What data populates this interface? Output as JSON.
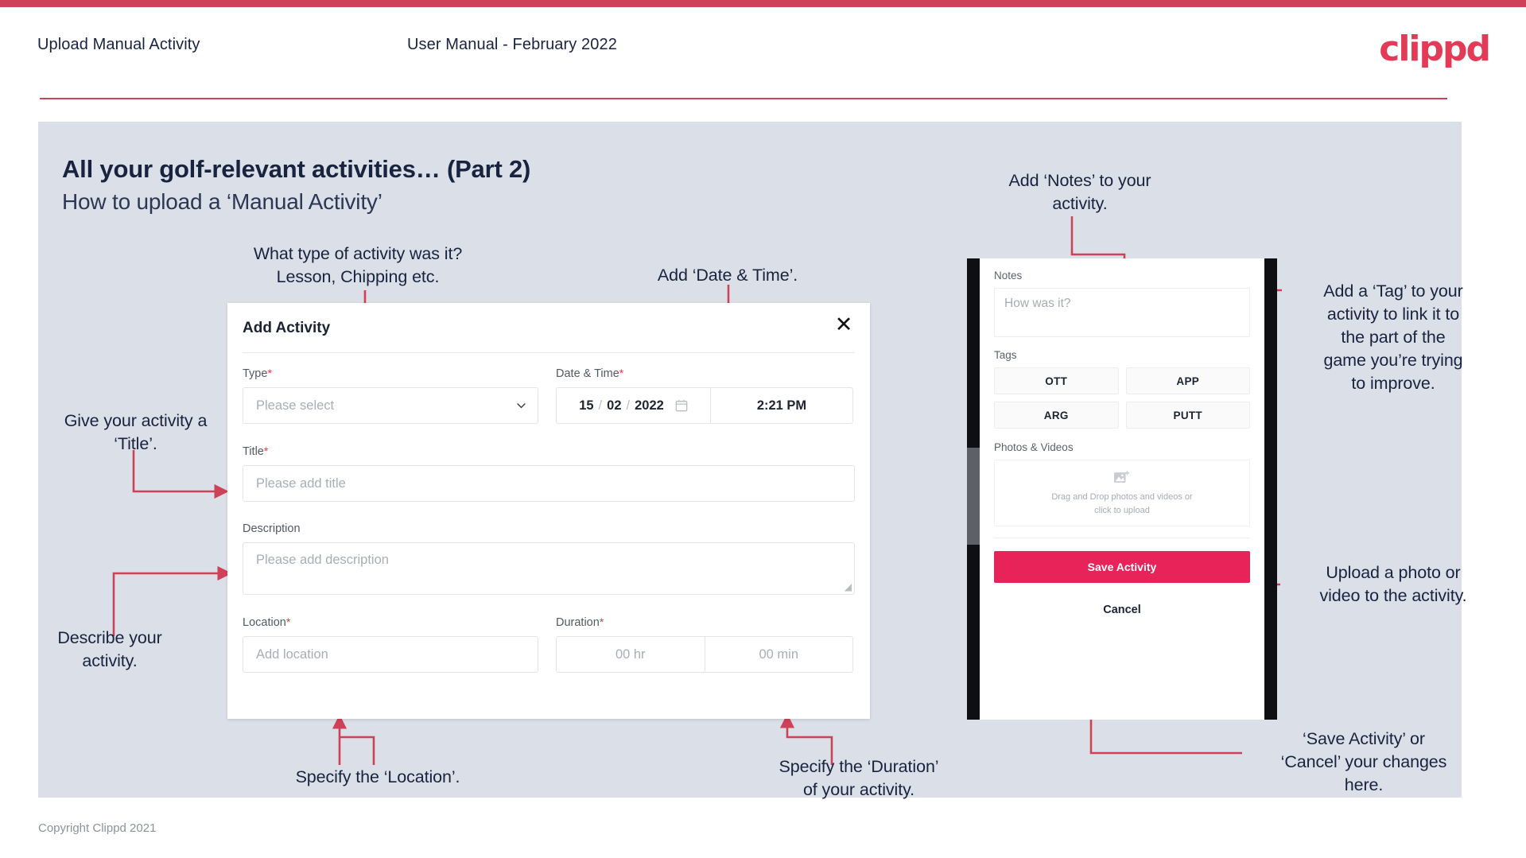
{
  "header": {
    "title": "Upload Manual Activity",
    "subtitle": "User Manual - February 2022",
    "logo": "clippd"
  },
  "slide": {
    "title": "All your golf-relevant activities… (Part 2)",
    "subtitle": "How to upload a ‘Manual Activity’"
  },
  "annotations": {
    "type": "What type of activity was it?\nLesson, Chipping etc.",
    "datetime": "Add ‘Date & Time’.",
    "title": "Give your activity a\n‘Title’.",
    "description": "Describe your\nactivity.",
    "location": "Specify the ‘Location’.",
    "duration": "Specify the ‘Duration’\nof your activity.",
    "notes": "Add ‘Notes’ to your\nactivity.",
    "tags": "Add a ‘Tag’ to your\nactivity to link it to\nthe part of the\ngame you’re trying\nto improve.",
    "photos": "Upload a photo or\nvideo to the activity.",
    "save": "‘Save Activity’ or\n‘Cancel’ your changes\nhere."
  },
  "dialog": {
    "title": "Add Activity",
    "close_label": "✕",
    "fields": {
      "type": {
        "label": "Type",
        "required": true,
        "placeholder": "Please select"
      },
      "datetime": {
        "label": "Date & Time",
        "required": true,
        "day": "15",
        "month": "02",
        "year": "2022",
        "separator": "/",
        "time": "2:21 PM"
      },
      "title": {
        "label": "Title",
        "required": true,
        "placeholder": "Please add title"
      },
      "description": {
        "label": "Description",
        "required": false,
        "placeholder": "Please add description"
      },
      "location": {
        "label": "Location",
        "required": true,
        "placeholder": "Add location"
      },
      "duration": {
        "label": "Duration",
        "required": true,
        "hours_placeholder": "00 hr",
        "minutes_placeholder": "00 min"
      }
    },
    "required_marker": "*"
  },
  "phone": {
    "notes": {
      "label": "Notes",
      "placeholder": "How was it?"
    },
    "tags": {
      "label": "Tags",
      "items": [
        "OTT",
        "APP",
        "ARG",
        "PUTT"
      ]
    },
    "photos": {
      "label": "Photos & Videos",
      "drop_line1": "Drag and Drop photos and videos or",
      "drop_line2": "click to upload"
    },
    "save_label": "Save Activity",
    "cancel_label": "Cancel"
  },
  "footer": {
    "copyright": "Copyright Clippd 2021"
  },
  "colors": {
    "accent": "#cf4158",
    "brand": "#e23a57",
    "save_button": "#e8235a",
    "slide_bg": "#dbe0e8",
    "text_dark": "#18233f"
  }
}
